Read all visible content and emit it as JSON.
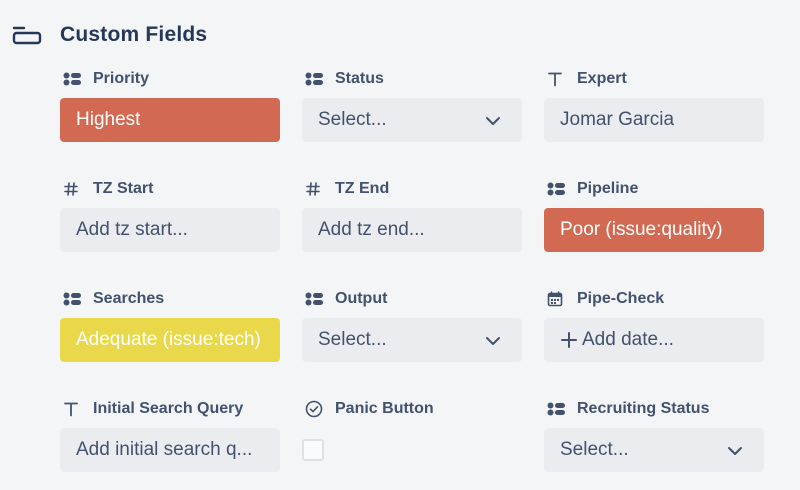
{
  "section": {
    "title": "Custom Fields",
    "icon": "panel-icon"
  },
  "fields": {
    "priority": {
      "label": "Priority",
      "icon": "select-list-icon",
      "value": "Highest"
    },
    "status": {
      "label": "Status",
      "icon": "select-list-icon",
      "value": "Select..."
    },
    "expert": {
      "label": "Expert",
      "icon": "text-icon",
      "value": "Jomar Garcia"
    },
    "tz_start": {
      "label": "TZ Start",
      "icon": "hash-icon",
      "placeholder": "Add tz start..."
    },
    "tz_end": {
      "label": "TZ End",
      "icon": "hash-icon",
      "placeholder": "Add tz end..."
    },
    "pipeline": {
      "label": "Pipeline",
      "icon": "select-list-icon",
      "value": "Poor (issue:quality)"
    },
    "searches": {
      "label": "Searches",
      "icon": "select-list-icon",
      "value": "Adequate (issue:tech)"
    },
    "output": {
      "label": "Output",
      "icon": "select-list-icon",
      "value": "Select..."
    },
    "pipe_check": {
      "label": "Pipe-Check",
      "icon": "calendar-icon",
      "placeholder": "Add date..."
    },
    "initial_search_query": {
      "label": "Initial Search Query",
      "icon": "text-icon",
      "placeholder": "Add initial search q..."
    },
    "panic_button": {
      "label": "Panic Button",
      "icon": "check-circle-icon",
      "checked": false
    },
    "recruiting_status": {
      "label": "Recruiting Status",
      "icon": "select-list-icon",
      "value": "Select..."
    }
  },
  "colors": {
    "red": "#d26a53",
    "yellow": "#e8d84a",
    "field_bg": "#ebecf0",
    "page_bg": "#f4f5f7"
  }
}
